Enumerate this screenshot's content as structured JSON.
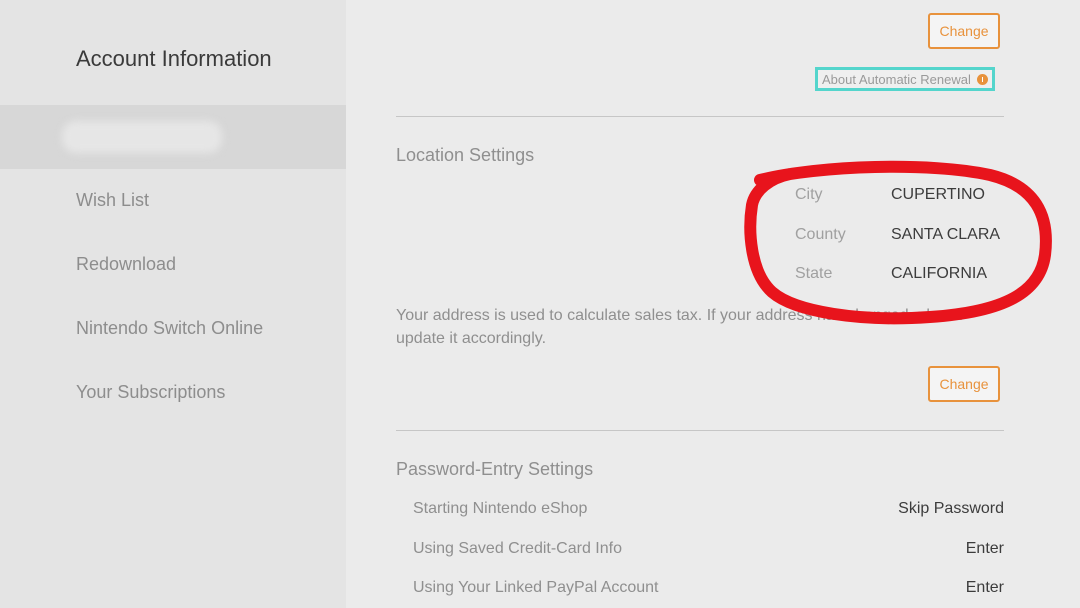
{
  "sidebar": {
    "title": "Account Information",
    "items": [
      {
        "label": "Wish List"
      },
      {
        "label": "Redownload"
      },
      {
        "label": "Nintendo Switch Online"
      },
      {
        "label": "Your Subscriptions"
      }
    ]
  },
  "main": {
    "change_label": "Change",
    "renewal_link": "About Automatic Renewal",
    "location": {
      "title": "Location Settings",
      "rows": [
        {
          "label": "City",
          "value": "CUPERTINO"
        },
        {
          "label": "County",
          "value": "SANTA CLARA"
        },
        {
          "label": "State",
          "value": "CALIFORNIA"
        }
      ],
      "note": "Your address is used to calculate sales tax. If your address has changed, please update it accordingly."
    },
    "password": {
      "title": "Password-Entry Settings",
      "rows": [
        {
          "label": "Starting Nintendo eShop",
          "value": "Skip Password"
        },
        {
          "label": "Using Saved Credit-Card Info",
          "value": "Enter"
        },
        {
          "label": "Using Your Linked PayPal Account",
          "value": "Enter"
        }
      ]
    }
  },
  "colors": {
    "accent": "#e8923c",
    "highlight_box": "#54d5cc",
    "annotation": "#e8141c"
  }
}
